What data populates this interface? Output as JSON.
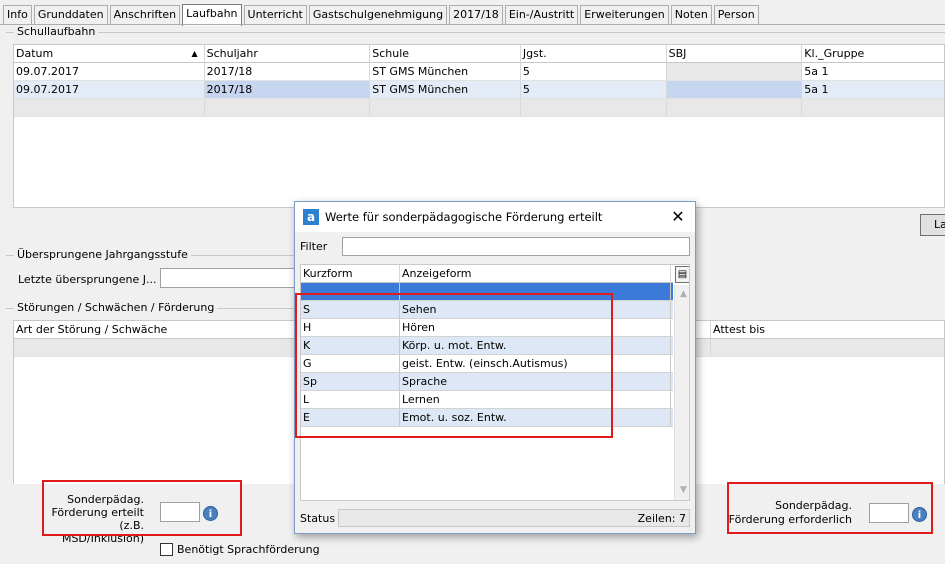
{
  "tabs": [
    "Info",
    "Grunddaten",
    "Anschriften",
    "Laufbahn",
    "Unterricht",
    "Gastschulgenehmigung",
    "2017/18",
    "Ein-/Austritt",
    "Erweiterungen",
    "Noten",
    "Person"
  ],
  "active_tab": "Laufbahn",
  "schullaufbahn": {
    "group_label": "Schullaufbahn",
    "columns": [
      "Datum",
      "Schuljahr",
      "Schule",
      "Jgst.",
      "SBJ",
      "Kl._Gruppe"
    ],
    "rows": [
      [
        "09.07.2017",
        "2017/18",
        "ST GMS München",
        "5",
        "",
        "5a 1"
      ],
      [
        "09.07.2017",
        "2017/18",
        "ST GMS München",
        "5",
        "",
        "5a 1"
      ]
    ],
    "right_button_label": "La"
  },
  "uebersprungen": {
    "group_label": "Übersprungene Jahrgangsstufe",
    "field_label": "Letzte übersprungene J...",
    "field_value": ""
  },
  "stoerungen": {
    "group_label": "Störungen / Schwächen / Förderung",
    "columns": [
      "Art der Störung / Schwäche",
      "Attest bis"
    ]
  },
  "foerderung_erteilt": {
    "label_lines": [
      "Sonderpädag.",
      "Förderung erteilt",
      "(z.B. MSD/Inklusion)"
    ],
    "value": ""
  },
  "foerderung_erforderlich": {
    "label_lines": [
      "Sonderpädag.",
      "Förderung erforderlich"
    ],
    "value": ""
  },
  "sprachfoerderung": {
    "label": "Benötigt Sprachförderung",
    "checked": false
  },
  "dialog": {
    "title": "Werte für sonderpädagogische Förderung erteilt",
    "filter_label": "Filter",
    "filter_value": "",
    "columns": [
      "Kurzform",
      "Anzeigeform"
    ],
    "rows": [
      [
        "",
        ""
      ],
      [
        "S",
        "Sehen"
      ],
      [
        "H",
        "Hören"
      ],
      [
        "K",
        "Körp. u. mot. Entw."
      ],
      [
        "G",
        "geist. Entw. (einsch.Autismus)"
      ],
      [
        "Sp",
        "Sprache"
      ],
      [
        "L",
        "Lernen"
      ],
      [
        "E",
        "Emot. u. soz. Entw."
      ]
    ],
    "status_label": "Status",
    "count_text": "Zeilen: 7"
  },
  "colors": {
    "highlight": "#e01b1b",
    "selection": "#3b7ad8",
    "accent": "#4a7fc0"
  },
  "icons": [
    "app-icon",
    "close-icon",
    "info-icon",
    "sort-ascending-icon",
    "column-chooser-icon"
  ]
}
